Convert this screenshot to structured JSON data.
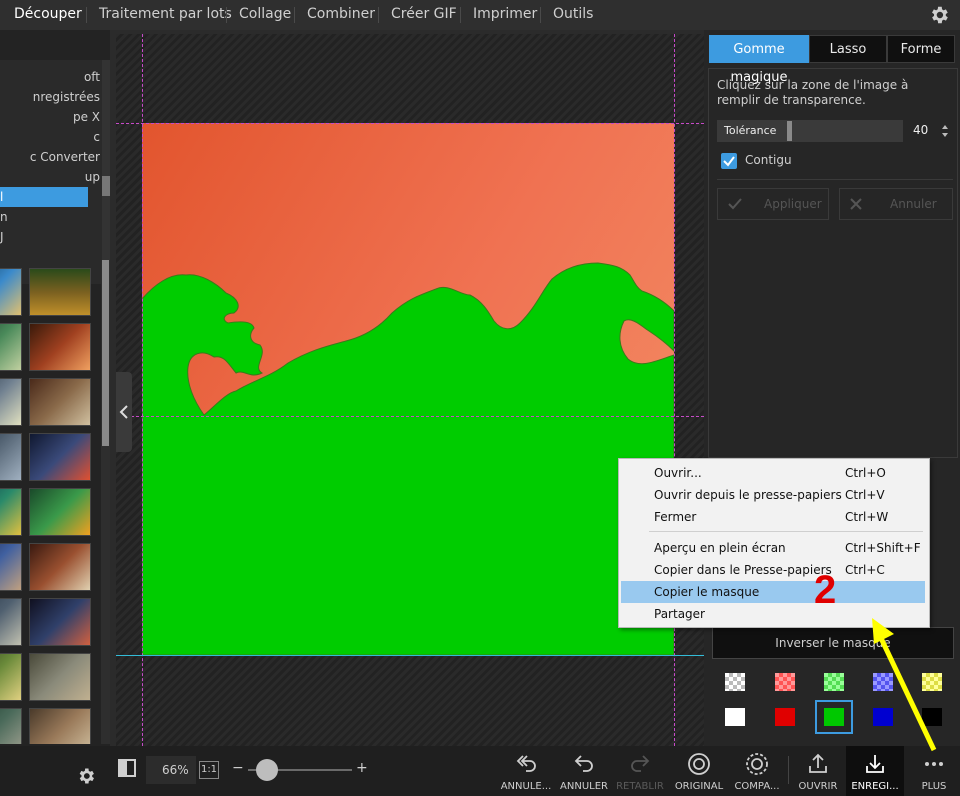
{
  "topbar": {
    "menus": [
      "Découper",
      "Traitement par lots",
      "Collage",
      "Combiner",
      "Créer GIF",
      "Imprimer",
      "Outils"
    ],
    "settings_icon": "gear-icon"
  },
  "left_panel": {
    "list": [
      "oft",
      "nregistrées",
      "pe X",
      "c",
      "c Converter",
      "up",
      "l",
      "n",
      "J"
    ],
    "selected_index": 6
  },
  "right_panel": {
    "tabs": [
      "Gomme magique",
      "Lasso",
      "Forme"
    ],
    "instructions": "Cliquez sur la zone de l'image à remplir de transparence.",
    "tolerance_label": "Tolérance",
    "tolerance_value": "40",
    "contiguous_label": "Contigu",
    "apply_label": "Appliquer",
    "cancel_label": "Annuler",
    "invert_mask_label": "Inverser le masque",
    "swatch_colors": [
      "#ffffff",
      "#ff5555",
      "#55ff55",
      "#5555ff",
      "#ffff55",
      "#ffffff",
      "#e00000",
      "#00c800",
      "#0000d0",
      "#000000"
    ]
  },
  "bottombar": {
    "zoom": "66%",
    "actual_size": "1:1",
    "zoom_minus": "−",
    "zoom_plus": "+",
    "tools": [
      "ANNULE...",
      "ANNULER",
      "RÉTABLIR",
      "ORIGINAL",
      "COMPA...",
      "OUVRIR",
      "ENREGI...",
      "PLUS"
    ]
  },
  "context_menu": {
    "items": [
      {
        "label": "Ouvrir...",
        "shortcut": "Ctrl+O"
      },
      {
        "label": "Ouvrir depuis le presse-papiers",
        "shortcut": "Ctrl+V"
      },
      {
        "label": "Fermer",
        "shortcut": "Ctrl+W"
      },
      {
        "label": "Aperçu en plein écran",
        "shortcut": "Ctrl+Shift+F"
      },
      {
        "label": "Copier dans le Presse-papiers",
        "shortcut": "Ctrl+C"
      },
      {
        "label": "Copier le masque",
        "shortcut": ""
      },
      {
        "label": "Partager",
        "shortcut": ""
      }
    ],
    "highlighted_index": 5
  },
  "annotation": {
    "number": "2",
    "arrow_color": "#ffff00",
    "number_color": "#e00000"
  },
  "colors": {
    "accent": "#3d9be0",
    "mask_green": "#00cc00",
    "sky_orange": "#ee6f48"
  }
}
